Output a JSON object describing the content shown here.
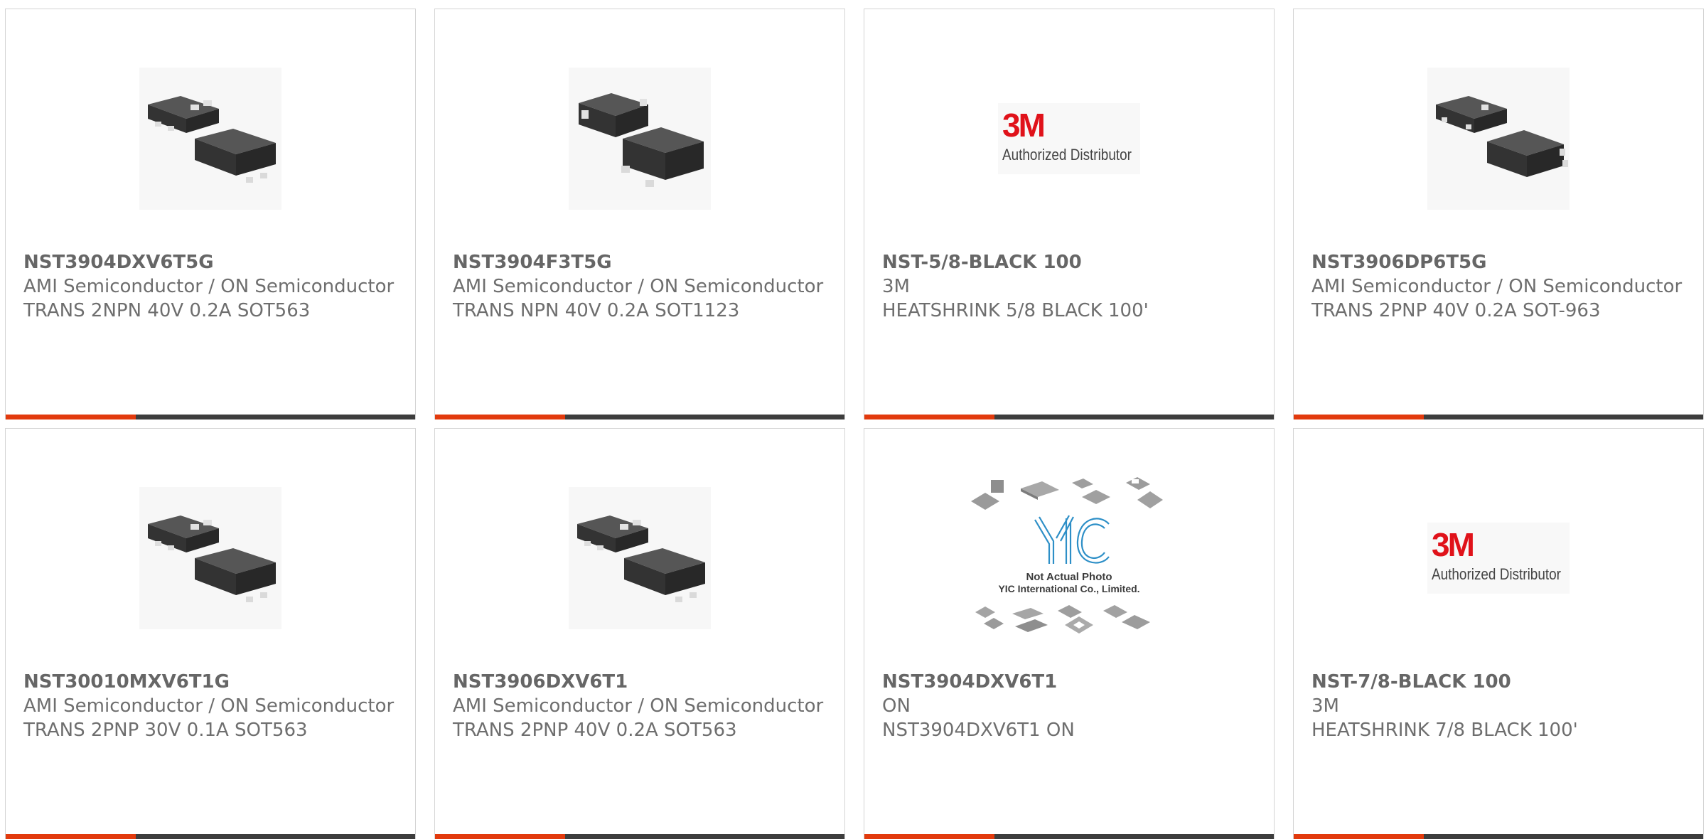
{
  "accent_color": "#e23a0d",
  "bar_dark_color": "#3d3d3d",
  "logo_color": "#e0121a",
  "products": [
    {
      "part_number": "NST3904DXV6T5G",
      "manufacturer": "AMI Semiconductor / ON Semiconductor",
      "description": "TRANS 2NPN 40V 0.2A SOT563",
      "image": "sot563-package-photo"
    },
    {
      "part_number": "NST3904F3T5G",
      "manufacturer": "AMI Semiconductor / ON Semiconductor",
      "description": "TRANS NPN 40V 0.2A SOT1123",
      "image": "sot1123-package-photo"
    },
    {
      "part_number": "NST-5/8-BLACK 100",
      "manufacturer": "3M",
      "description": "HEATSHRINK 5/8 BLACK 100'",
      "image": "3m-logo",
      "logo_text": "3M",
      "logo_subtext": "Authorized Distributor"
    },
    {
      "part_number": "NST3906DP6T5G",
      "manufacturer": "AMI Semiconductor / ON Semiconductor",
      "description": "TRANS 2PNP 40V 0.2A SOT-963",
      "image": "sot963-package-photo"
    },
    {
      "part_number": "NST30010MXV6T1G",
      "manufacturer": "AMI Semiconductor / ON Semiconductor",
      "description": "TRANS 2PNP 30V 0.1A SOT563",
      "image": "sot563-package-photo"
    },
    {
      "part_number": "NST3906DXV6T1",
      "manufacturer": "AMI Semiconductor / ON Semiconductor",
      "description": "TRANS 2PNP 40V 0.2A SOT563",
      "image": "sot563-package-photo"
    },
    {
      "part_number": "NST3904DXV6T1",
      "manufacturer": "ON",
      "description": "NST3904DXV6T1 ON",
      "image": "yic-placeholder-photo",
      "placeholder_line1": "Not Actual Photo",
      "placeholder_line2": "YIC International Co., Limited."
    },
    {
      "part_number": "NST-7/8-BLACK 100",
      "manufacturer": "3M",
      "description": "HEATSHRINK 7/8 BLACK 100'",
      "image": "3m-logo",
      "logo_text": "3M",
      "logo_subtext": "Authorized Distributor"
    }
  ]
}
